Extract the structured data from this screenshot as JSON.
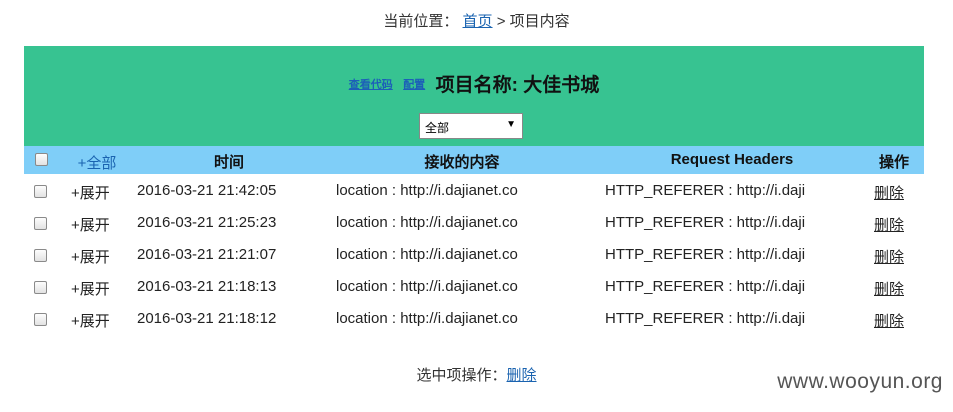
{
  "breadcrumb": {
    "prefix": "当前位置：",
    "home": "首页",
    "separator": ">",
    "current": "项目内容"
  },
  "header": {
    "view_code": "查看代码",
    "config": "配置",
    "project_title": "项目名称: 大佳书城",
    "background_color": "#37c391"
  },
  "filter": {
    "selected": "全部",
    "arrow_icon": "triangle-down-icon"
  },
  "table": {
    "header_color": "#7fcef8",
    "columns": {
      "expand_all": "+全部",
      "time": "时间",
      "content": "接收的内容",
      "headers": "Request Headers",
      "action": "操作"
    },
    "rows": [
      {
        "expand": "+展开",
        "time": "2016-03-21 21:42:05",
        "content": "location : http://i.dajianet.co",
        "headers": "HTTP_REFERER : http://i.daji",
        "action": "删除"
      },
      {
        "expand": "+展开",
        "time": "2016-03-21 21:25:23",
        "content": "location : http://i.dajianet.co",
        "headers": "HTTP_REFERER : http://i.daji",
        "action": "删除"
      },
      {
        "expand": "+展开",
        "time": "2016-03-21 21:21:07",
        "content": "location : http://i.dajianet.co",
        "headers": "HTTP_REFERER : http://i.daji",
        "action": "删除"
      },
      {
        "expand": "+展开",
        "time": "2016-03-21 21:18:13",
        "content": "location : http://i.dajianet.co",
        "headers": "HTTP_REFERER : http://i.daji",
        "action": "删除"
      },
      {
        "expand": "+展开",
        "time": "2016-03-21 21:18:12",
        "content": "location : http://i.dajianet.co",
        "headers": "HTTP_REFERER : http://i.daji",
        "action": "删除"
      }
    ]
  },
  "footer": {
    "label": "选中项操作：",
    "delete": "删除"
  },
  "watermark": "www.wooyun.org"
}
